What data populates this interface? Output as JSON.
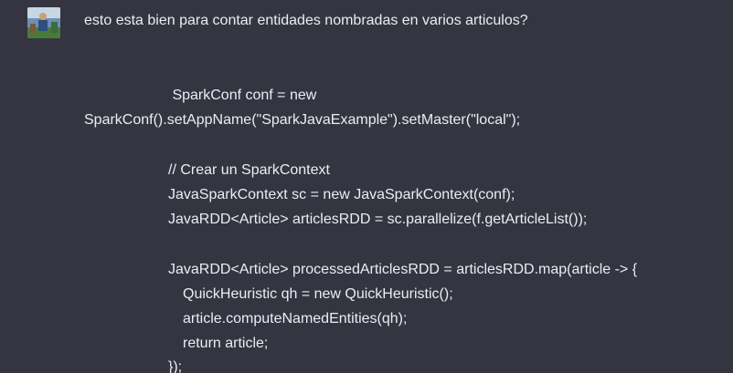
{
  "message": {
    "question": "esto esta bien para contar entidades nombradas en varios articulos?",
    "code_lines": [
      " SparkConf conf = new",
      "SparkConf().setAppName(\"SparkJavaExample\").setMaster(\"local\");",
      "// Crear un SparkContext",
      "JavaSparkContext sc = new JavaSparkContext(conf);",
      "JavaRDD<Article> articlesRDD = sc.parallelize(f.getArticleList());",
      "JavaRDD<Article> processedArticlesRDD = articlesRDD.map(article -> {",
      "QuickHeuristic qh = new QuickHeuristic();",
      "article.computeNamedEntities(qh);",
      "return article;",
      "});"
    ]
  },
  "colors": {
    "background": "#343541",
    "text": "#ececf1"
  }
}
